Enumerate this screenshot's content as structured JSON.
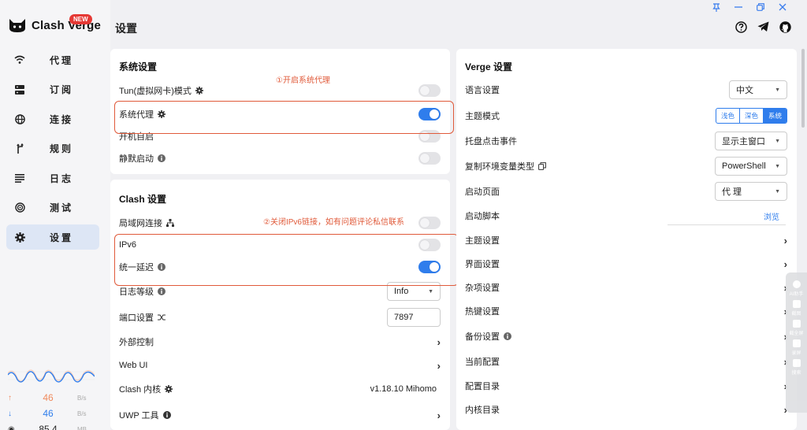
{
  "app": {
    "name": "Clash Verge",
    "badge": "NEW"
  },
  "nav": [
    {
      "id": "proxies",
      "label": "代理",
      "icon": "wifi-icon"
    },
    {
      "id": "profiles",
      "label": "订阅",
      "icon": "server-icon"
    },
    {
      "id": "connections",
      "label": "连接",
      "icon": "globe-icon"
    },
    {
      "id": "rules",
      "label": "规则",
      "icon": "fork-icon"
    },
    {
      "id": "logs",
      "label": "日志",
      "icon": "list-icon"
    },
    {
      "id": "test",
      "label": "测试",
      "icon": "radar-icon"
    },
    {
      "id": "settings",
      "label": "设置",
      "icon": "gear-icon",
      "active": true
    }
  ],
  "traffic": {
    "up": {
      "value": "46",
      "unit": "B/s",
      "color": "#f08a5d"
    },
    "down": {
      "value": "46",
      "unit": "B/s",
      "color": "#2f7dec"
    },
    "memory": {
      "value": "85.4",
      "unit": "MB"
    }
  },
  "header": {
    "title": "设置"
  },
  "system_settings": {
    "title": "系统设置",
    "annotation": "①开启系统代理",
    "rows": [
      {
        "label": "Tun(虚拟网卡)模式",
        "icon": "gear-icon",
        "toggle": false
      },
      {
        "label": "系统代理",
        "icon": "gear-icon",
        "toggle": true
      },
      {
        "label": "开机自启",
        "toggle": false
      },
      {
        "label": "静默启动",
        "icon": "info-icon",
        "toggle": false
      }
    ]
  },
  "clash_settings": {
    "title": "Clash 设置",
    "annotation": "②关闭IPv6链接，如有问题评论私信联系",
    "lan": {
      "label": "局域网连接",
      "toggle": false
    },
    "ipv6": {
      "label": "IPv6",
      "toggle": false
    },
    "unified_delay": {
      "label": "统一延迟",
      "toggle": true
    },
    "log_level": {
      "label": "日志等级",
      "value": "Info"
    },
    "port": {
      "label": "端口设置",
      "value": "7897"
    },
    "external": {
      "label": "外部控制"
    },
    "webui": {
      "label": "Web UI"
    },
    "core": {
      "label": "Clash 内核",
      "value": "v1.18.10 Mihomo"
    },
    "uwp": {
      "label": "UWP 工具"
    }
  },
  "verge_settings": {
    "title": "Verge 设置",
    "language": {
      "label": "语言设置",
      "value": "中文"
    },
    "theme_mode": {
      "label": "主题模式",
      "options": [
        "浅色",
        "深色",
        "系统"
      ],
      "selected": 2
    },
    "tray_click": {
      "label": "托盘点击事件",
      "value": "显示主窗口"
    },
    "env_type": {
      "label": "复制环境变量类型",
      "value": "PowerShell"
    },
    "start_page": {
      "label": "启动页面",
      "value": "代 理"
    },
    "start_script": {
      "label": "启动脚本",
      "action": "浏览"
    },
    "links": [
      "主题设置",
      "界面设置",
      "杂项设置",
      "热键设置",
      "备份设置",
      "当前配置",
      "配置目录",
      "内核目录"
    ]
  },
  "float_toolbar": [
    "AI助手",
    "截图",
    "截全屏",
    "录屏",
    "搜索"
  ]
}
